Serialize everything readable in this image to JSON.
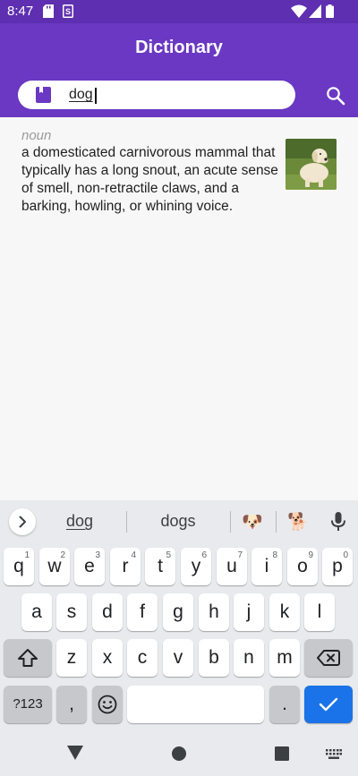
{
  "status_bar": {
    "time": "8:47"
  },
  "app_bar": {
    "title": "Dictionary",
    "search_value": "dog"
  },
  "entry": {
    "part_of_speech": "noun",
    "definition": "a domesticated carnivorous mammal that typically has a long snout, an acute sense of smell, non-retractile claws, and a barking, howling, or whining voice."
  },
  "keyboard": {
    "suggestions": [
      "dog",
      "dogs"
    ],
    "emoji_suggestions": [
      "🐶",
      "🐕"
    ],
    "row1": [
      {
        "k": "q",
        "h": "1"
      },
      {
        "k": "w",
        "h": "2"
      },
      {
        "k": "e",
        "h": "3"
      },
      {
        "k": "r",
        "h": "4"
      },
      {
        "k": "t",
        "h": "5"
      },
      {
        "k": "y",
        "h": "6"
      },
      {
        "k": "u",
        "h": "7"
      },
      {
        "k": "i",
        "h": "8"
      },
      {
        "k": "o",
        "h": "9"
      },
      {
        "k": "p",
        "h": "0"
      }
    ],
    "row2": [
      "a",
      "s",
      "d",
      "f",
      "g",
      "h",
      "j",
      "k",
      "l"
    ],
    "row3": [
      "z",
      "x",
      "c",
      "v",
      "b",
      "n",
      "m"
    ],
    "symbols_label": "?123",
    "comma_label": ",",
    "period_label": ".",
    "colors": {
      "accent": "#1a73e8",
      "app_bar": "#6a38c2",
      "status_bar": "#5e2fb0"
    }
  }
}
